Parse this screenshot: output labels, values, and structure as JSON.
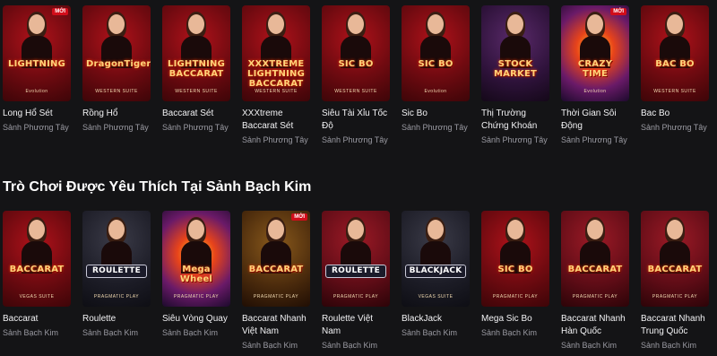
{
  "row1": [
    {
      "logo": "LIGHTNING",
      "title": "Long Hổ Sét",
      "sub": "Sảnh Phương Tây",
      "badge": "MỚI",
      "suite": "Evolution",
      "bg": "red"
    },
    {
      "logo": "DragonTiger",
      "title": "Rồng Hổ",
      "sub": "Sảnh Phương Tây",
      "badge": "",
      "suite": "WESTERN SUITE",
      "bg": "red"
    },
    {
      "logo": "LIGHTNING BACCARAT",
      "title": "Baccarat Sét",
      "sub": "Sảnh Phương Tây",
      "badge": "",
      "suite": "WESTERN SUITE",
      "bg": "red"
    },
    {
      "logo": "XXXTREME LIGHTNING BACCARAT",
      "title": "XXXtreme Baccarat Sét",
      "sub": "Sảnh Phương Tây",
      "badge": "",
      "suite": "WESTERN SUITE",
      "bg": "red"
    },
    {
      "logo": "SIC BO",
      "title": "Siêu Tài Xỉu Tốc Độ",
      "sub": "Sảnh Phương Tây",
      "badge": "",
      "suite": "WESTERN SUITE",
      "bg": "red"
    },
    {
      "logo": "SIC BO",
      "title": "Sic Bo",
      "sub": "Sảnh Phương Tây",
      "badge": "",
      "suite": "Evolution",
      "bg": "red"
    },
    {
      "logo": "STOCK MARKET",
      "title": "Thị Trường Chứng Khoán",
      "sub": "Sảnh Phương Tây",
      "badge": "",
      "suite": "",
      "bg": "stock"
    },
    {
      "logo": "CRAZY TIME",
      "title": "Thời Gian Sôi Động",
      "sub": "Sảnh Phương Tây",
      "badge": "MỚI",
      "suite": "Evolution",
      "bg": "wheel"
    },
    {
      "logo": "BAC BO",
      "title": "Bac Bo",
      "sub": "Sảnh Phương Tây",
      "badge": "",
      "suite": "WESTERN SUITE",
      "bg": "red"
    }
  ],
  "section_title": "Trò Chơi Được Yêu Thích Tại Sảnh Bạch Kim",
  "row2": [
    {
      "logo": "BACCARAT",
      "title": "Baccarat",
      "sub": "Sảnh Bạch Kim",
      "badge": "",
      "suite": "VEGAS SUITE",
      "bg": "red"
    },
    {
      "logo": "ROULETTE",
      "title": "Roulette",
      "sub": "Sảnh Bạch Kim",
      "badge": "",
      "suite": "PRAGMATIC PLAY",
      "bg": "dark"
    },
    {
      "logo": "Mega Wheel",
      "title": "Siêu Vòng Quay",
      "sub": "Sảnh Bạch Kim",
      "badge": "",
      "suite": "PRAGMATIC PLAY",
      "bg": "wheel"
    },
    {
      "logo": "BACCARAT",
      "title": "Baccarat Nhanh Việt Nam",
      "sub": "Sảnh Bạch Kim",
      "badge": "MỚI",
      "suite": "PRAGMATIC PLAY",
      "bg": "gold"
    },
    {
      "logo": "ROULETTE",
      "title": "Roulette Việt Nam",
      "sub": "Sảnh Bạch Kim",
      "badge": "",
      "suite": "PRAGMATIC PLAY",
      "bg": "bordeaux"
    },
    {
      "logo": "BLACKJACK",
      "title": "BlackJack",
      "sub": "Sảnh Bạch Kim",
      "badge": "",
      "suite": "VEGAS SUITE",
      "bg": "dark"
    },
    {
      "logo": "SIC BO",
      "title": "Mega Sic Bo",
      "sub": "Sảnh Bạch Kim",
      "badge": "",
      "suite": "PRAGMATIC PLAY",
      "bg": "red"
    },
    {
      "logo": "BACCARAT",
      "title": "Baccarat Nhanh Hàn Quốc",
      "sub": "Sảnh Bạch Kim",
      "badge": "",
      "suite": "PRAGMATIC PLAY",
      "bg": "bordeaux"
    },
    {
      "logo": "BACCARAT",
      "title": "Baccarat Nhanh Trung Quốc",
      "sub": "Sảnh Bạch Kim",
      "badge": "",
      "suite": "PRAGMATIC PLAY",
      "bg": "bordeaux"
    }
  ]
}
